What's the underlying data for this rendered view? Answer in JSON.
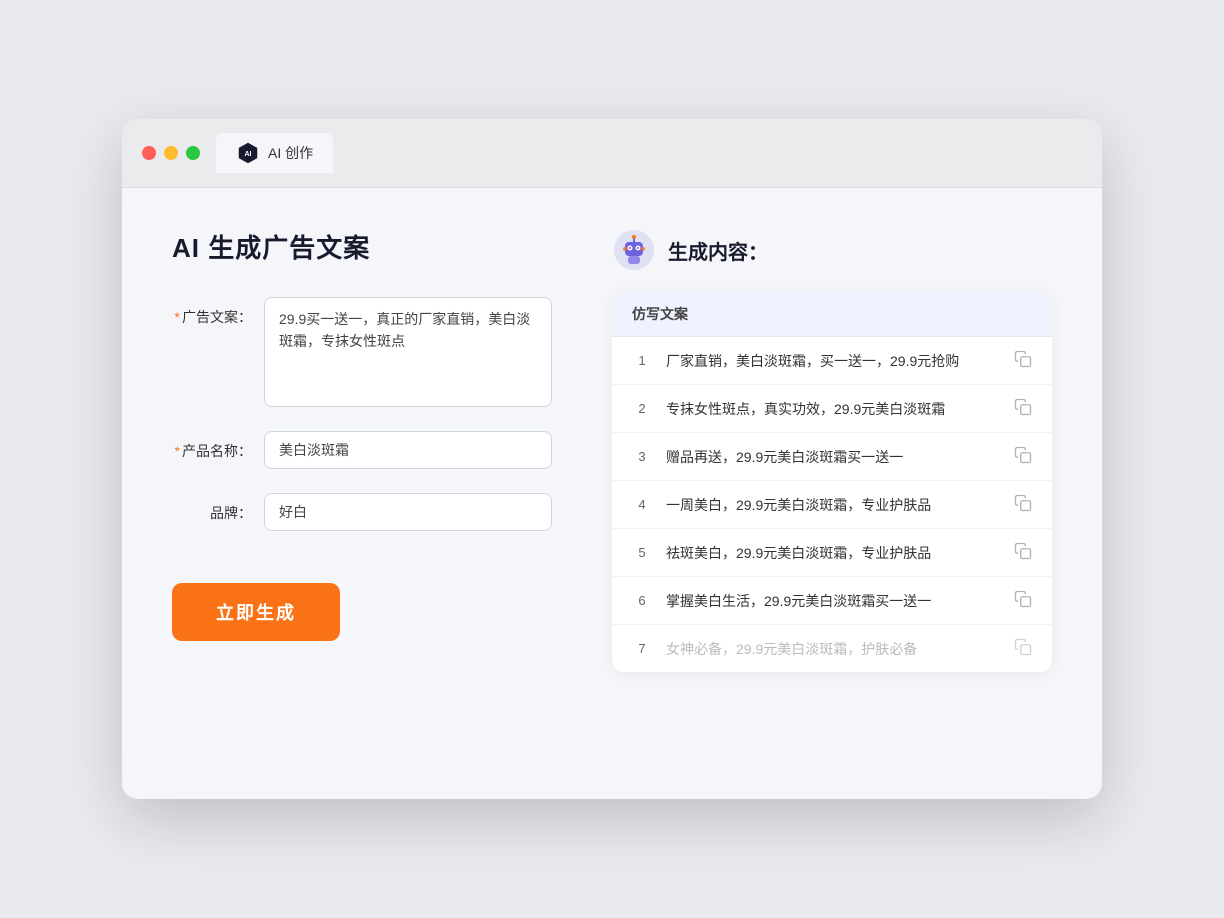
{
  "browser": {
    "tab_title": "AI 创作"
  },
  "page": {
    "title": "AI 生成广告文案",
    "result_title": "生成内容："
  },
  "form": {
    "ad_copy_label": "广告文案：",
    "ad_copy_required": "*",
    "ad_copy_value": "29.9买一送一，真正的厂家直销，美白淡斑霜，专抹女性斑点",
    "product_name_label": "产品名称：",
    "product_name_required": "*",
    "product_name_value": "美白淡斑霜",
    "brand_label": "品牌：",
    "brand_value": "好白",
    "submit_label": "立即生成"
  },
  "results": {
    "column_label": "仿写文案",
    "items": [
      {
        "num": "1",
        "text": "厂家直销，美白淡斑霜，买一送一，29.9元抢购",
        "dimmed": false
      },
      {
        "num": "2",
        "text": "专抹女性斑点，真实功效，29.9元美白淡斑霜",
        "dimmed": false
      },
      {
        "num": "3",
        "text": "赠品再送，29.9元美白淡斑霜买一送一",
        "dimmed": false
      },
      {
        "num": "4",
        "text": "一周美白，29.9元美白淡斑霜，专业护肤品",
        "dimmed": false
      },
      {
        "num": "5",
        "text": "祛斑美白，29.9元美白淡斑霜，专业护肤品",
        "dimmed": false
      },
      {
        "num": "6",
        "text": "掌握美白生活，29.9元美白淡斑霜买一送一",
        "dimmed": false
      },
      {
        "num": "7",
        "text": "女神必备，29.9元美白淡斑霜，护肤必备",
        "dimmed": true
      }
    ]
  }
}
